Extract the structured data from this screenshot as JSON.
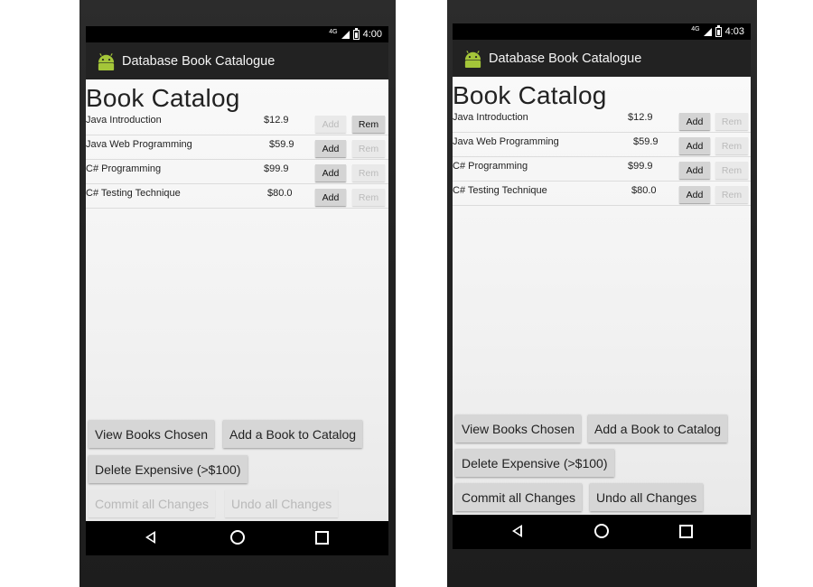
{
  "colors": {
    "status_bar": "#000000",
    "action_bar": "#222222",
    "screen_bg": "#f2f2f2",
    "button": "#d6d6d6",
    "android_green": "#a4c639"
  },
  "app": {
    "title": "Database Book Catalogue",
    "heading": "Book Catalog"
  },
  "icons": {
    "app_icon": "android-icon",
    "status": [
      "network-4g-icon",
      "signal-icon",
      "battery-icon"
    ],
    "nav": [
      "back-icon",
      "home-icon",
      "recents-icon"
    ]
  },
  "phones": [
    {
      "status": {
        "network": "4G",
        "time": "4:00"
      },
      "books": [
        {
          "name": "Java Introduction",
          "price": "$12.9",
          "add": "Add",
          "rem": "Rem",
          "add_enabled": false,
          "rem_enabled": true
        },
        {
          "name": "Java Web Programming",
          "price": "$59.9",
          "add": "Add",
          "rem": "Rem",
          "add_enabled": true,
          "rem_enabled": false
        },
        {
          "name": "C# Programming",
          "price": "$99.9",
          "add": "Add",
          "rem": "Rem",
          "add_enabled": true,
          "rem_enabled": false
        },
        {
          "name": "C# Testing Technique",
          "price": "$80.0",
          "add": "Add",
          "rem": "Rem",
          "add_enabled": true,
          "rem_enabled": false
        }
      ],
      "buttons": {
        "view_books": "View Books Chosen",
        "add_book": "Add a Book to Catalog",
        "delete_expensive": "Delete Expensive (>$100)",
        "commit": "Commit all Changes",
        "undo": "Undo all Changes",
        "commit_enabled": false,
        "undo_enabled": false
      }
    },
    {
      "status": {
        "network": "4G",
        "time": "4:03"
      },
      "books": [
        {
          "name": "Java Introduction",
          "price": "$12.9",
          "add": "Add",
          "rem": "Rem",
          "add_enabled": true,
          "rem_enabled": false
        },
        {
          "name": "Java Web Programming",
          "price": "$59.9",
          "add": "Add",
          "rem": "Rem",
          "add_enabled": true,
          "rem_enabled": false
        },
        {
          "name": "C# Programming",
          "price": "$99.9",
          "add": "Add",
          "rem": "Rem",
          "add_enabled": true,
          "rem_enabled": false
        },
        {
          "name": "C# Testing Technique",
          "price": "$80.0",
          "add": "Add",
          "rem": "Rem",
          "add_enabled": true,
          "rem_enabled": false
        }
      ],
      "buttons": {
        "view_books": "View Books Chosen",
        "add_book": "Add a Book to Catalog",
        "delete_expensive": "Delete Expensive (>$100)",
        "commit": "Commit all Changes",
        "undo": "Undo all Changes",
        "commit_enabled": true,
        "undo_enabled": true
      }
    }
  ]
}
